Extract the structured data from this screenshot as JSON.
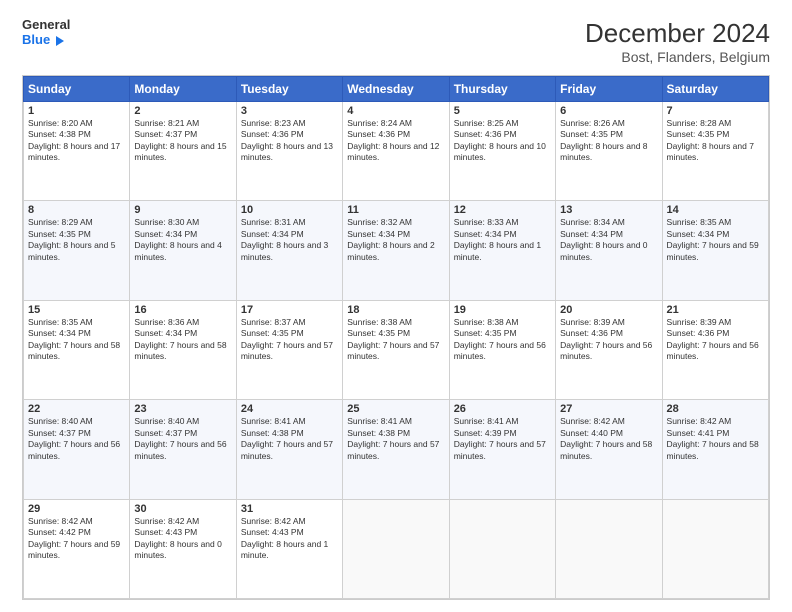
{
  "header": {
    "logo_line1": "General",
    "logo_line2": "Blue",
    "title": "December 2024",
    "subtitle": "Bost, Flanders, Belgium"
  },
  "calendar": {
    "days_of_week": [
      "Sunday",
      "Monday",
      "Tuesday",
      "Wednesday",
      "Thursday",
      "Friday",
      "Saturday"
    ],
    "weeks": [
      [
        {
          "day": "1",
          "sunrise": "8:20 AM",
          "sunset": "4:38 PM",
          "daylight": "8 hours and 17 minutes."
        },
        {
          "day": "2",
          "sunrise": "8:21 AM",
          "sunset": "4:37 PM",
          "daylight": "8 hours and 15 minutes."
        },
        {
          "day": "3",
          "sunrise": "8:23 AM",
          "sunset": "4:36 PM",
          "daylight": "8 hours and 13 minutes."
        },
        {
          "day": "4",
          "sunrise": "8:24 AM",
          "sunset": "4:36 PM",
          "daylight": "8 hours and 12 minutes."
        },
        {
          "day": "5",
          "sunrise": "8:25 AM",
          "sunset": "4:36 PM",
          "daylight": "8 hours and 10 minutes."
        },
        {
          "day": "6",
          "sunrise": "8:26 AM",
          "sunset": "4:35 PM",
          "daylight": "8 hours and 8 minutes."
        },
        {
          "day": "7",
          "sunrise": "8:28 AM",
          "sunset": "4:35 PM",
          "daylight": "8 hours and 7 minutes."
        }
      ],
      [
        {
          "day": "8",
          "sunrise": "8:29 AM",
          "sunset": "4:35 PM",
          "daylight": "8 hours and 5 minutes."
        },
        {
          "day": "9",
          "sunrise": "8:30 AM",
          "sunset": "4:34 PM",
          "daylight": "8 hours and 4 minutes."
        },
        {
          "day": "10",
          "sunrise": "8:31 AM",
          "sunset": "4:34 PM",
          "daylight": "8 hours and 3 minutes."
        },
        {
          "day": "11",
          "sunrise": "8:32 AM",
          "sunset": "4:34 PM",
          "daylight": "8 hours and 2 minutes."
        },
        {
          "day": "12",
          "sunrise": "8:33 AM",
          "sunset": "4:34 PM",
          "daylight": "8 hours and 1 minute."
        },
        {
          "day": "13",
          "sunrise": "8:34 AM",
          "sunset": "4:34 PM",
          "daylight": "8 hours and 0 minutes."
        },
        {
          "day": "14",
          "sunrise": "8:35 AM",
          "sunset": "4:34 PM",
          "daylight": "7 hours and 59 minutes."
        }
      ],
      [
        {
          "day": "15",
          "sunrise": "8:35 AM",
          "sunset": "4:34 PM",
          "daylight": "7 hours and 58 minutes."
        },
        {
          "day": "16",
          "sunrise": "8:36 AM",
          "sunset": "4:34 PM",
          "daylight": "7 hours and 58 minutes."
        },
        {
          "day": "17",
          "sunrise": "8:37 AM",
          "sunset": "4:35 PM",
          "daylight": "7 hours and 57 minutes."
        },
        {
          "day": "18",
          "sunrise": "8:38 AM",
          "sunset": "4:35 PM",
          "daylight": "7 hours and 57 minutes."
        },
        {
          "day": "19",
          "sunrise": "8:38 AM",
          "sunset": "4:35 PM",
          "daylight": "7 hours and 56 minutes."
        },
        {
          "day": "20",
          "sunrise": "8:39 AM",
          "sunset": "4:36 PM",
          "daylight": "7 hours and 56 minutes."
        },
        {
          "day": "21",
          "sunrise": "8:39 AM",
          "sunset": "4:36 PM",
          "daylight": "7 hours and 56 minutes."
        }
      ],
      [
        {
          "day": "22",
          "sunrise": "8:40 AM",
          "sunset": "4:37 PM",
          "daylight": "7 hours and 56 minutes."
        },
        {
          "day": "23",
          "sunrise": "8:40 AM",
          "sunset": "4:37 PM",
          "daylight": "7 hours and 56 minutes."
        },
        {
          "day": "24",
          "sunrise": "8:41 AM",
          "sunset": "4:38 PM",
          "daylight": "7 hours and 57 minutes."
        },
        {
          "day": "25",
          "sunrise": "8:41 AM",
          "sunset": "4:38 PM",
          "daylight": "7 hours and 57 minutes."
        },
        {
          "day": "26",
          "sunrise": "8:41 AM",
          "sunset": "4:39 PM",
          "daylight": "7 hours and 57 minutes."
        },
        {
          "day": "27",
          "sunrise": "8:42 AM",
          "sunset": "4:40 PM",
          "daylight": "7 hours and 58 minutes."
        },
        {
          "day": "28",
          "sunrise": "8:42 AM",
          "sunset": "4:41 PM",
          "daylight": "7 hours and 58 minutes."
        }
      ],
      [
        {
          "day": "29",
          "sunrise": "8:42 AM",
          "sunset": "4:42 PM",
          "daylight": "7 hours and 59 minutes."
        },
        {
          "day": "30",
          "sunrise": "8:42 AM",
          "sunset": "4:43 PM",
          "daylight": "8 hours and 0 minutes."
        },
        {
          "day": "31",
          "sunrise": "8:42 AM",
          "sunset": "4:43 PM",
          "daylight": "8 hours and 1 minute."
        },
        null,
        null,
        null,
        null
      ]
    ]
  }
}
